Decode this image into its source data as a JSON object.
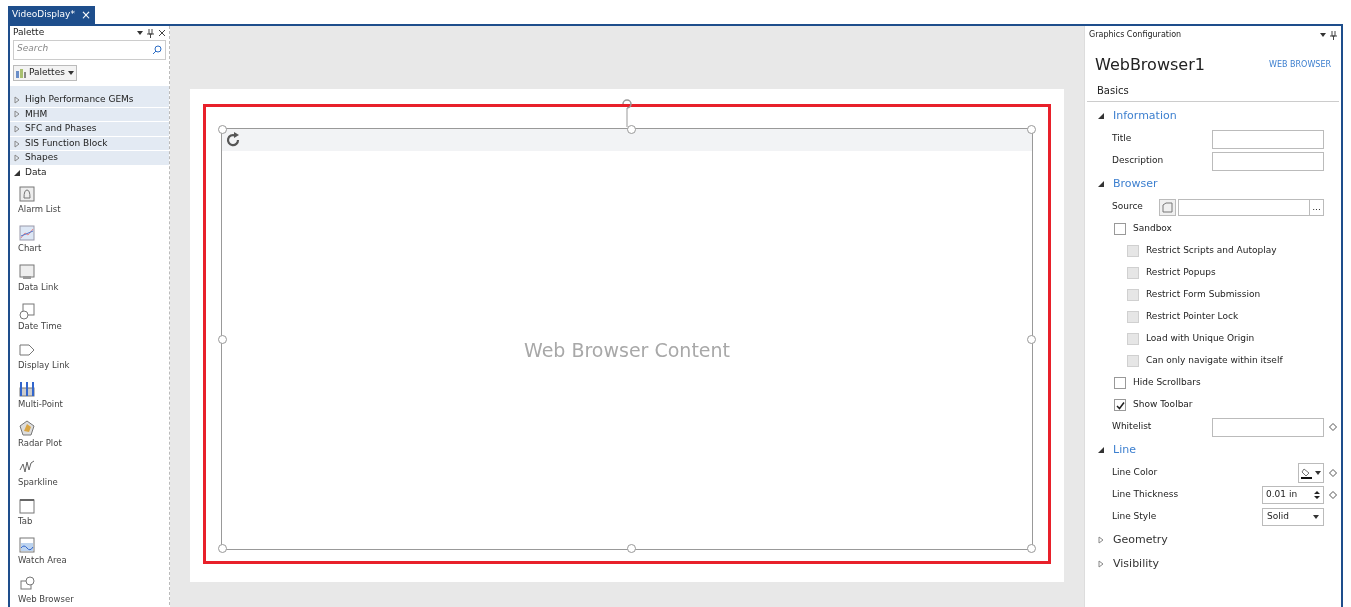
{
  "document_tab": {
    "title": "VideoDisplay*",
    "close": "×"
  },
  "palette": {
    "title": "Palette",
    "search_placeholder": "Search",
    "palettes_button": "Palettes",
    "categories": [
      {
        "label": "High Performance GEMs",
        "expanded": false
      },
      {
        "label": "MHM",
        "expanded": false
      },
      {
        "label": "SFC and Phases",
        "expanded": false
      },
      {
        "label": "SIS Function Block",
        "expanded": false
      },
      {
        "label": "Shapes",
        "expanded": false
      },
      {
        "label": "Data",
        "expanded": true
      }
    ],
    "items": [
      {
        "label": "Alarm List",
        "kind": "alarm"
      },
      {
        "label": "Chart",
        "kind": "chart"
      },
      {
        "label": "Data Link",
        "kind": "datalink"
      },
      {
        "label": "Date Time",
        "kind": "datetime"
      },
      {
        "label": "Display Link",
        "kind": "displaylink"
      },
      {
        "label": "Multi-Point",
        "kind": "multipoint"
      },
      {
        "label": "Radar Plot",
        "kind": "radar"
      },
      {
        "label": "Sparkline",
        "kind": "sparkline"
      },
      {
        "label": "Tab",
        "kind": "tab"
      },
      {
        "label": "Watch Area",
        "kind": "watch"
      },
      {
        "label": "Web Browser",
        "kind": "web"
      }
    ]
  },
  "canvas": {
    "content_label": "Web Browser Content",
    "selected": true
  },
  "config": {
    "title": "Graphics Configuration",
    "object_name": "WebBrowser1",
    "object_type": "WEB BROWSER",
    "tab": "Basics",
    "sections": [
      {
        "title": "Information",
        "expanded": true,
        "rows": [
          {
            "kind": "text",
            "label": "Title"
          },
          {
            "kind": "text",
            "label": "Description"
          }
        ]
      },
      {
        "title": "Browser",
        "expanded": true,
        "rows": [
          {
            "kind": "source",
            "label": "Source",
            "button": "..."
          },
          {
            "kind": "check",
            "label": "Sandbox",
            "checked": false,
            "disabled": false
          },
          {
            "kind": "subcheck",
            "label": "Restrict Scripts and Autoplay",
            "checked": false,
            "disabled": true
          },
          {
            "kind": "subcheck",
            "label": "Restrict Popups",
            "checked": false,
            "disabled": true
          },
          {
            "kind": "subcheck",
            "label": "Restrict Form Submission",
            "checked": false,
            "disabled": true
          },
          {
            "kind": "subcheck",
            "label": "Restrict Pointer Lock",
            "checked": false,
            "disabled": true
          },
          {
            "kind": "subcheck",
            "label": "Load with Unique Origin",
            "checked": false,
            "disabled": true
          },
          {
            "kind": "subcheck",
            "label": "Can only navigate within itself",
            "checked": false,
            "disabled": true
          },
          {
            "kind": "check",
            "label": "Hide Scrollbars",
            "checked": false,
            "disabled": false
          },
          {
            "kind": "check",
            "label": "Show Toolbar",
            "checked": true,
            "disabled": false
          },
          {
            "kind": "text",
            "label": "Whitelist",
            "diamond": true
          }
        ]
      },
      {
        "title": "Line",
        "expanded": true,
        "rows": [
          {
            "kind": "color",
            "label": "Line Color"
          },
          {
            "kind": "spinner",
            "label": "Line Thickness",
            "value": "0.01 in"
          },
          {
            "kind": "dropdown",
            "label": "Line Style",
            "value": "Solid"
          }
        ]
      },
      {
        "title": "Geometry",
        "expanded": false
      },
      {
        "title": "Visibility",
        "expanded": false
      }
    ]
  }
}
